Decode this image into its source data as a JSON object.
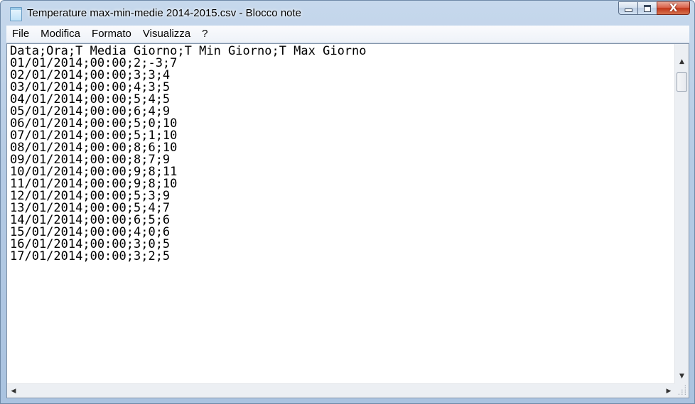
{
  "window": {
    "title": "Temperature max-min-medie 2014-2015.csv - Blocco note",
    "icon": "notepad-icon",
    "colors": {
      "frame": "#b5cbe4",
      "close_button": "#c1361a"
    }
  },
  "menu": {
    "items": [
      "File",
      "Modifica",
      "Formato",
      "Visualizza",
      "?"
    ]
  },
  "editor": {
    "lines": [
      "Data;Ora;T Media Giorno;T Min Giorno;T Max Giorno",
      "01/01/2014;00:00;2;-3;7",
      "02/01/2014;00:00;3;3;4",
      "03/01/2014;00:00;4;3;5",
      "04/01/2014;00:00;5;4;5",
      "05/01/2014;00:00;6;4;9",
      "06/01/2014;00:00;5;0;10",
      "07/01/2014;00:00;5;1;10",
      "08/01/2014;00:00;8;6;10",
      "09/01/2014;00:00;8;7;9",
      "10/01/2014;00:00;9;8;11",
      "11/01/2014;00:00;9;8;10",
      "12/01/2014;00:00;5;3;9",
      "13/01/2014;00:00;5;4;7",
      "14/01/2014;00:00;6;5;6",
      "15/01/2014;00:00;4;0;6",
      "16/01/2014;00:00;3;0;5",
      "17/01/2014;00:00;3;2;5"
    ]
  },
  "scrollbars": {
    "up_arrow": "▲",
    "down_arrow": "▼",
    "left_arrow": "◀",
    "right_arrow": "▶"
  },
  "caption": {
    "close_glyph": "X"
  }
}
